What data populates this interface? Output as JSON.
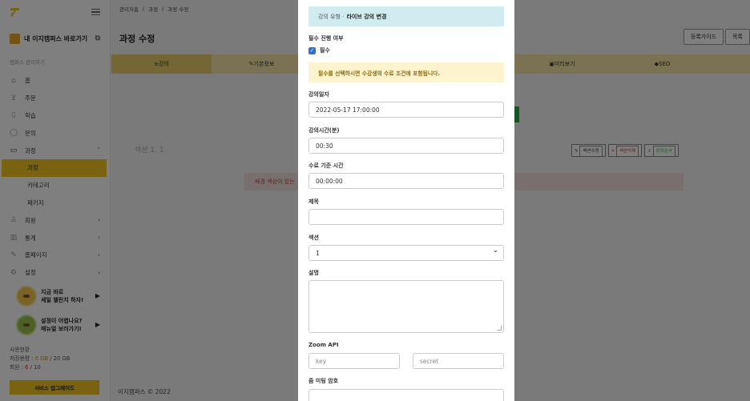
{
  "sidebar": {
    "campus_link": "내 이지캠퍼스 바로가기",
    "section_label": "캠퍼스 관리하기",
    "items": [
      {
        "label": "홈",
        "icon": "home-icon",
        "chev": ""
      },
      {
        "label": "주문",
        "icon": "cart-icon",
        "chev": ""
      },
      {
        "label": "학습",
        "icon": "book-icon",
        "chev": ""
      },
      {
        "label": "문의",
        "icon": "chat-icon",
        "chev": ""
      },
      {
        "label": "과정",
        "icon": "folder-icon",
        "chev": "˅"
      },
      {
        "label": "과정",
        "icon": "",
        "chev": ""
      },
      {
        "label": "카테고리",
        "icon": "",
        "chev": ""
      },
      {
        "label": "패키지",
        "icon": "",
        "chev": ""
      },
      {
        "label": "회원",
        "icon": "user-icon",
        "chev": "‹"
      },
      {
        "label": "통계",
        "icon": "chart-icon",
        "chev": "‹"
      },
      {
        "label": "홈페이지",
        "icon": "pencil-icon",
        "chev": "‹"
      },
      {
        "label": "설정",
        "icon": "gear-icon",
        "chev": "‹"
      }
    ],
    "promo1_line1": "지금 바로",
    "promo1_line2": "세일 챌린지 하자!",
    "promo2_line1": "설정이 어렵나요?",
    "promo2_line2": "매뉴얼 보러가기!",
    "usage_title": "사용현황",
    "storage_label": "저장용량 : ",
    "storage_used": "0 GB",
    "storage_total": " / 20 GB",
    "members_label": "회원 : ",
    "members_used": "6",
    "members_total": " / 10",
    "upgrade_label": "서비스 업그레이드"
  },
  "header": {
    "breadcrumb": [
      "관리자홈",
      "과정",
      "과정 수정"
    ],
    "title": "과정 수정",
    "btn_guide": "등록가이드",
    "btn_list": "목록"
  },
  "tabs": [
    "강의",
    "기본정보",
    "",
    "",
    "미리보기",
    "SEO"
  ],
  "section": {
    "label": "섹션 1. 1",
    "btn_edit": "섹션수정",
    "btn_delete": "섹션삭제",
    "btn_order": "강의순서",
    "warning": "배경 색상이 있는"
  },
  "footer": "이지캠퍼스 © 2022",
  "modal": {
    "type_label": "강의 유형 ·",
    "type_value": "라이브 강의  변경",
    "required_label": "필수 진행 여부",
    "required_checkbox": "필수",
    "required_notice": "필수를 선택하시면 수강생의 수료 조건에 포함됩니다.",
    "date_label": "강의일자",
    "date_value": "2022-05-17 17:00:00",
    "duration_label": "강의시간(분)",
    "duration_value": "00:30",
    "completion_label": "수료 기준 시간",
    "completion_value": "00:00:00",
    "title_label": "제목",
    "title_value": "",
    "section_label": "섹션",
    "section_value": "1",
    "desc_label": "설명",
    "zoom_label": "Zoom API",
    "zoom_key_placeholder": "key",
    "zoom_secret_placeholder": "secret",
    "password_label": "줌 미팅 암호"
  }
}
